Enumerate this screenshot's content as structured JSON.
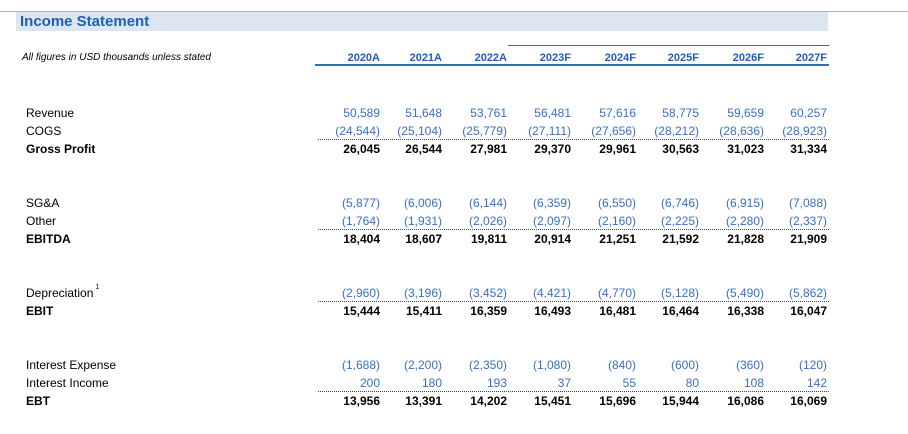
{
  "title": "Income Statement",
  "note": "All figures in USD thousands unless stated",
  "years": [
    "2020A",
    "2021A",
    "2022A",
    "2023F",
    "2024F",
    "2025F",
    "2026F",
    "2027F"
  ],
  "sections": [
    {
      "rows": [
        {
          "label": "Revenue",
          "sup": "",
          "bold": false,
          "values": [
            "50,589",
            "51,648",
            "53,761",
            "56,481",
            "57,616",
            "58,775",
            "59,659",
            "60,257"
          ]
        },
        {
          "label": "COGS",
          "sup": "",
          "bold": false,
          "values": [
            "(24,544)",
            "(25,104)",
            "(25,779)",
            "(27,111)",
            "(27,656)",
            "(28,212)",
            "(28,636)",
            "(28,923)"
          ]
        },
        {
          "label": "Gross Profit",
          "sup": "",
          "bold": true,
          "values": [
            "26,045",
            "26,544",
            "27,981",
            "29,370",
            "29,961",
            "30,563",
            "31,023",
            "31,334"
          ]
        }
      ]
    },
    {
      "rows": [
        {
          "label": "SG&A",
          "sup": "",
          "bold": false,
          "values": [
            "(5,877)",
            "(6,006)",
            "(6,144)",
            "(6,359)",
            "(6,550)",
            "(6,746)",
            "(6,915)",
            "(7,088)"
          ]
        },
        {
          "label": "Other",
          "sup": "",
          "bold": false,
          "values": [
            "(1,764)",
            "(1,931)",
            "(2,026)",
            "(2,097)",
            "(2,160)",
            "(2,225)",
            "(2,280)",
            "(2,337)"
          ]
        },
        {
          "label": "EBITDA",
          "sup": "",
          "bold": true,
          "values": [
            "18,404",
            "18,607",
            "19,811",
            "20,914",
            "21,251",
            "21,592",
            "21,828",
            "21,909"
          ]
        }
      ]
    },
    {
      "rows": [
        {
          "label": "Depreciation",
          "sup": "1",
          "bold": false,
          "values": [
            "(2,960)",
            "(3,196)",
            "(3,452)",
            "(4,421)",
            "(4,770)",
            "(5,128)",
            "(5,490)",
            "(5,862)"
          ]
        },
        {
          "label": "EBIT",
          "sup": "",
          "bold": true,
          "values": [
            "15,444",
            "15,411",
            "16,359",
            "16,493",
            "16,481",
            "16,464",
            "16,338",
            "16,047"
          ]
        }
      ]
    },
    {
      "rows": [
        {
          "label": "Interest Expense",
          "sup": "",
          "bold": false,
          "values": [
            "(1,688)",
            "(2,200)",
            "(2,350)",
            "(1,080)",
            "(840)",
            "(600)",
            "(360)",
            "(120)"
          ]
        },
        {
          "label": "Interest Income",
          "sup": "",
          "bold": false,
          "values": [
            "200",
            "180",
            "193",
            "37",
            "55",
            "80",
            "108",
            "142"
          ]
        },
        {
          "label": "EBT",
          "sup": "",
          "bold": true,
          "values": [
            "13,956",
            "13,391",
            "14,202",
            "15,451",
            "15,696",
            "15,944",
            "16,086",
            "16,069"
          ]
        }
      ]
    }
  ]
}
